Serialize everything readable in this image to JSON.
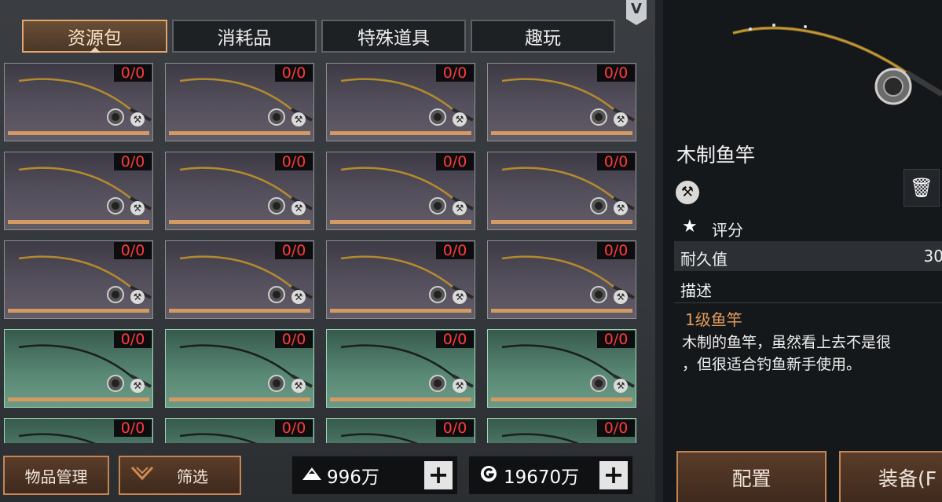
{
  "tabs": [
    {
      "label": "资源包",
      "active": true
    },
    {
      "label": "消耗品",
      "active": false
    },
    {
      "label": "特殊道具",
      "active": false
    },
    {
      "label": "趣玩",
      "active": false
    }
  ],
  "badge_letter": "V",
  "grid": {
    "rows": [
      [
        "0/0",
        "0/0",
        "0/0",
        "0/0"
      ],
      [
        "0/0",
        "0/0",
        "0/0",
        "0/0"
      ],
      [
        "0/0",
        "0/0",
        "0/0",
        "0/0"
      ],
      [
        "0/0",
        "0/0",
        "0/0",
        "0/0"
      ],
      [
        "0/0",
        "0/0",
        "0/0",
        "0/0"
      ]
    ],
    "row_rarity": [
      "purple",
      "purple",
      "purple",
      "green",
      "green"
    ],
    "item_icon": "fishing-rod-icon",
    "tool_badge_icon": "pickaxe-icon"
  },
  "bottom": {
    "manage_label": "物品管理",
    "filter_label": "筛选",
    "currency1": {
      "icon": "mountain-icon",
      "amount": "996万"
    },
    "currency2": {
      "icon": "g-coin-icon",
      "amount": "19670万"
    }
  },
  "detail": {
    "item_name": "木制鱼竿",
    "rating_label": "评分",
    "durability_label": "耐久值",
    "durability_value": "30",
    "description_label": "描述",
    "level": "1级鱼竿",
    "description_line1": "木制的鱼竿，虽然看上去不是很",
    "description_line2": "，但很适合钓鱼新手使用。",
    "configure_label": "配置",
    "equip_label": "装备(F"
  },
  "colors": {
    "accent": "#e3a36c",
    "count_text": "#ff3b3b",
    "level_text": "#e39b5d"
  }
}
